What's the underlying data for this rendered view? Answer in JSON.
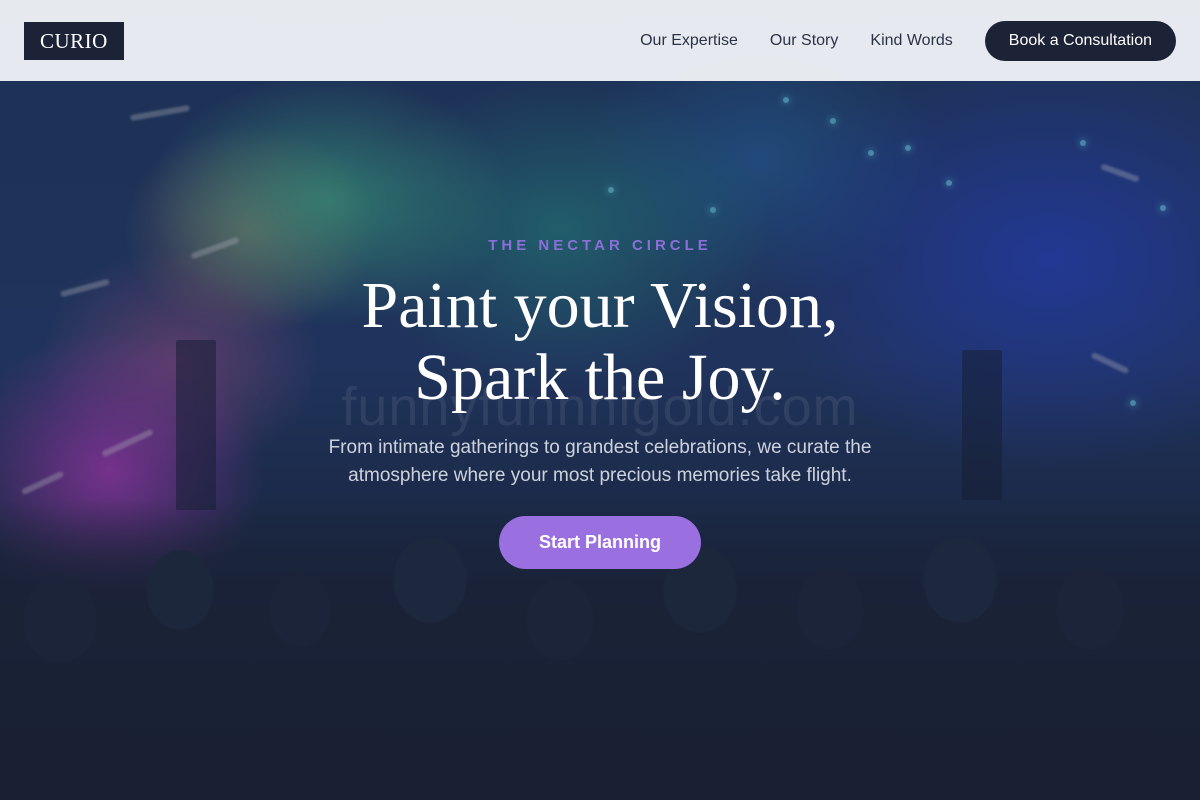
{
  "header": {
    "logo": "CURIO",
    "nav": [
      {
        "label": "Our Expertise"
      },
      {
        "label": "Our Story"
      },
      {
        "label": "Kind Words"
      }
    ],
    "cta_label": "Book a Consultation"
  },
  "hero": {
    "eyebrow": "THE NECTAR CIRCLE",
    "headline_line1": "Paint your Vision,",
    "headline_line2": "Spark the Joy.",
    "subtext": "From intimate gatherings to grandest celebrations, we curate the atmosphere where your most precious memories take flight.",
    "button_label": "Start Planning",
    "watermark": "funnyfunnnigold.com"
  },
  "colors": {
    "header_bg": "#ecf0f4",
    "navy": "#1c2336",
    "accent_purple": "#9a6fe0",
    "eyebrow_purple": "#8b6fd9"
  }
}
